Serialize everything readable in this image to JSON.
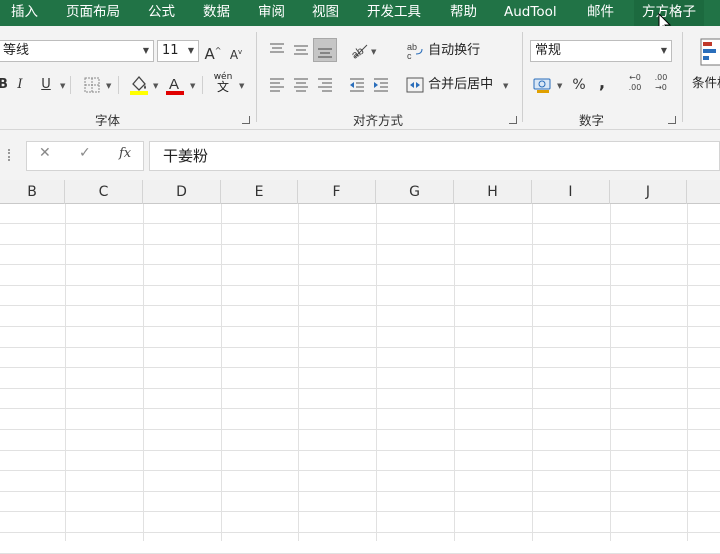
{
  "menu": {
    "tabs": [
      "插入",
      "页面布局",
      "公式",
      "数据",
      "审阅",
      "视图",
      "开发工具",
      "帮助",
      "AudTool",
      "邮件",
      "方方格子"
    ]
  },
  "ribbon": {
    "font": {
      "font_name": "等线",
      "font_size": "11",
      "grow_glyph": "A",
      "shrink_glyph": "A",
      "bold": "B",
      "italic": "I",
      "underline": "U",
      "wen": "wén",
      "wen_char": "文",
      "group_label": "字体"
    },
    "alignment": {
      "wrap_text": "自动换行",
      "merge_center": "合并后居中",
      "group_label": "对齐方式"
    },
    "number": {
      "format": "常规",
      "percent": "%",
      "comma": ",",
      "inc_decimal": "←0 .00",
      "dec_decimal": ".00 →0",
      "group_label": "数字"
    },
    "styles": {
      "conditional_format": "条件格"
    }
  },
  "formula_bar": {
    "cancel": "✕",
    "enter": "✓",
    "fx": "fx",
    "value": "干姜粉"
  },
  "grid": {
    "columns": [
      "B",
      "C",
      "D",
      "E",
      "F",
      "G",
      "H",
      "I",
      "J"
    ]
  },
  "colors": {
    "menu_bg": "#217346",
    "ribbon_bg": "#f3f3f3",
    "highlight_yellow": "#ffff00",
    "font_red": "#e00000"
  }
}
